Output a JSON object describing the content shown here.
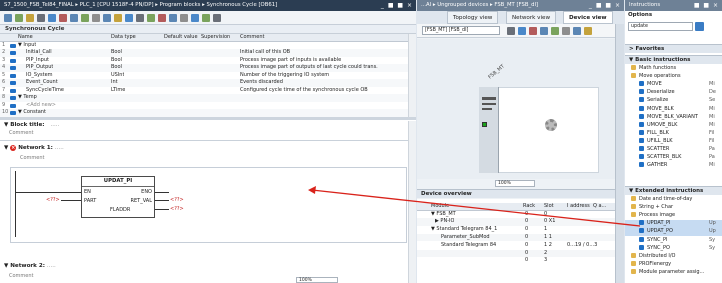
{
  "left": {
    "title": "S7_1500_FSB_Tel84_FINAL ▸ PLC_1 [CPU 1518F-4 PN/DP] ▸ Program blocks ▸ Synchronous Cycle [OB61]",
    "window_controls": "_ ■ ■ ×",
    "block_name": "Synchronous Cycle",
    "columns": [
      "Name",
      "Data type",
      "Default value",
      "Supervision",
      "Comment"
    ],
    "rows": [
      {
        "no": "1",
        "name": "▼ Input",
        "type": "",
        "comment": ""
      },
      {
        "no": "2",
        "name": "Initial_Call",
        "type": "Bool",
        "comment": "Initial call of this OB"
      },
      {
        "no": "3",
        "name": "PIP_Input",
        "type": "Bool",
        "comment": "Process image part of inputs is available"
      },
      {
        "no": "4",
        "name": "PIP_Output",
        "type": "Bool",
        "comment": "Process image part of outputs of last cycle could trans."
      },
      {
        "no": "5",
        "name": "IO_System",
        "type": "USInt",
        "comment": "Number of the triggering IO system"
      },
      {
        "no": "6",
        "name": "Event_Count",
        "type": "Int",
        "comment": "Events discarded"
      },
      {
        "no": "7",
        "name": "SyncCycleTime",
        "type": "LTime",
        "comment": "Configured cycle time of the synchronous cycle OB"
      },
      {
        "no": "8",
        "name": "▼ Temp",
        "type": "",
        "comment": ""
      },
      {
        "no": "9",
        "name": "<Add new>",
        "type": "",
        "comment": ""
      },
      {
        "no": "10",
        "name": "▼ Constant",
        "type": "",
        "comment": ""
      }
    ],
    "block_title": "▼ Block title:",
    "block_title_dots": ".....",
    "comment_label": "Comment",
    "network1": "Network 1:",
    "network1_dots": ".....",
    "fb_name": "UPDAT_PI",
    "pins_left": [
      "EN",
      "PART",
      "FLADDR"
    ],
    "pins_right": [
      "ENO",
      "RET_VAL",
      ""
    ],
    "param_placeholder": "<??>",
    "network2": "Network 2:",
    "network2_dots": ".....",
    "zoom": "100%"
  },
  "middle": {
    "title": "...AI ▸ Ungrouped devices ▸ FSB_MT [FSB_dI]",
    "window_controls": "_ ■ ■ ×",
    "tabs": [
      "Topology view",
      "Network view",
      "Device view"
    ],
    "device_select": "[FSB_MT] [FSB_dI]",
    "device_label": "FSB_MT",
    "zoom": "100%",
    "overview_title": "Device overview",
    "overview_columns": [
      "Module",
      "Rack",
      "Slot",
      "I address",
      "Q a..."
    ],
    "overview_rows": [
      {
        "module": "▼ FSB_MT",
        "rack": "0",
        "slot": "0",
        "iaddr": ""
      },
      {
        "module": "▶ PN-IO",
        "rack": "0",
        "slot": "0 X1",
        "iaddr": ""
      },
      {
        "module": "▼ Standard Telegram 84_1",
        "rack": "0",
        "slot": "1",
        "iaddr": ""
      },
      {
        "module": "Parameter_SubMod",
        "rack": "0",
        "slot": "1 1",
        "iaddr": ""
      },
      {
        "module": "Standard Telegram 84",
        "rack": "0",
        "slot": "1 2",
        "iaddr": "0...19 / 0...3"
      },
      {
        "module": "",
        "rack": "0",
        "slot": "2",
        "iaddr": ""
      },
      {
        "module": "",
        "rack": "0",
        "slot": "3",
        "iaddr": ""
      }
    ]
  },
  "right": {
    "title": "Instructions",
    "window_controls": "■ ■ ×",
    "options_label": "Options",
    "search_value": "update",
    "favorites": "> Favorites",
    "basic": "▼ Basic instructions",
    "basic_items": [
      {
        "label": "Math functions",
        "indent": 1,
        "folder": true
      },
      {
        "label": "Move operations",
        "indent": 1,
        "folder": true
      },
      {
        "label": "MOVE",
        "indent": 2,
        "folder": false,
        "right": "Mi"
      },
      {
        "label": "Deserialize",
        "indent": 2,
        "folder": false,
        "right": "De"
      },
      {
        "label": "Serialize",
        "indent": 2,
        "folder": false,
        "right": "Se"
      },
      {
        "label": "MOVE_BLK",
        "indent": 2,
        "folder": false,
        "right": "Mi"
      },
      {
        "label": "MOVE_BLK_VARIANT",
        "indent": 2,
        "folder": false,
        "right": "Mi"
      },
      {
        "label": "UMOVE_BLK",
        "indent": 2,
        "folder": false,
        "right": "Mi"
      },
      {
        "label": "FILL_BLK",
        "indent": 2,
        "folder": false,
        "right": "Fil"
      },
      {
        "label": "UFILL_BLK",
        "indent": 2,
        "folder": false,
        "right": "Fil"
      },
      {
        "label": "SCATTER",
        "indent": 2,
        "folder": false,
        "right": "Pa"
      },
      {
        "label": "SCATTER_BLK",
        "indent": 2,
        "folder": false,
        "right": "Pa"
      },
      {
        "label": "GATHER",
        "indent": 2,
        "folder": false,
        "right": "Mi"
      }
    ],
    "extended": "▼ Extended instructions",
    "ext_items": [
      {
        "label": "Date and time-of-day",
        "indent": 1,
        "folder": true,
        "right": ""
      },
      {
        "label": "String + Char",
        "indent": 1,
        "folder": true,
        "right": ""
      },
      {
        "label": "Process image",
        "indent": 1,
        "folder": true,
        "right": ""
      },
      {
        "label": "UPDAT_PI",
        "indent": 2,
        "folder": false,
        "right": "Up"
      },
      {
        "label": "UPDAT_PO",
        "indent": 2,
        "folder": false,
        "right": "Up"
      },
      {
        "label": "SYNC_PI",
        "indent": 2,
        "folder": false,
        "right": "Sy"
      },
      {
        "label": "SYNC_PO",
        "indent": 2,
        "folder": false,
        "right": "Sy"
      },
      {
        "label": "Distributed I/O",
        "indent": 1,
        "folder": true,
        "right": ""
      },
      {
        "label": "PROFlenergy",
        "indent": 1,
        "folder": true,
        "right": ""
      },
      {
        "label": "Module parameter assig...",
        "indent": 1,
        "folder": true,
        "right": ""
      }
    ]
  },
  "colors": {
    "titlebar": "#2b3d52",
    "select": "#c6dbf2",
    "arrow": "#d9231b",
    "accent": "#1f6fc5"
  }
}
